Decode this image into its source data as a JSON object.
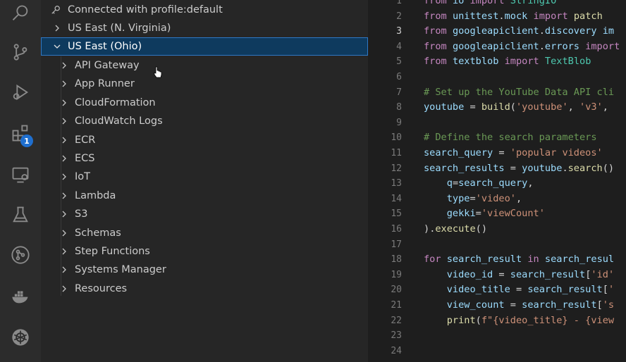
{
  "activity_bar": {
    "icons": [
      "search-icon",
      "source-control-icon",
      "run-debug-icon",
      "extensions-icon",
      "remote-explorer-icon",
      "testing-icon",
      "git-graph-icon",
      "docker-icon",
      "kubernetes-icon"
    ],
    "extensions_badge": "1"
  },
  "explorer": {
    "connection_label": "Connected with profile:default",
    "regions": [
      {
        "label": "US East (N. Virginia)",
        "expanded": false
      },
      {
        "label": "US East (Ohio)",
        "expanded": true
      }
    ],
    "services": [
      "API Gateway",
      "App Runner",
      "CloudFormation",
      "CloudWatch Logs",
      "ECR",
      "ECS",
      "IoT",
      "Lambda",
      "S3",
      "Schemas",
      "Step Functions",
      "Systems Manager",
      "Resources"
    ]
  },
  "editor": {
    "current_line": 3,
    "lines": [
      {
        "n": "1",
        "text": "from io import StringIO"
      },
      {
        "n": "2",
        "text": "from unittest.mock import patch"
      },
      {
        "n": "3",
        "text": "from googleapiclient.discovery im"
      },
      {
        "n": "4",
        "text": "from googleapiclient.errors import"
      },
      {
        "n": "5",
        "text": "from textblob import TextBlob"
      },
      {
        "n": "6",
        "text": ""
      },
      {
        "n": "7",
        "text": "# Set up the YouTube Data API cli"
      },
      {
        "n": "8",
        "text": "youtube = build('youtube', 'v3', "
      },
      {
        "n": "9",
        "text": ""
      },
      {
        "n": "10",
        "text": "# Define the search parameters"
      },
      {
        "n": "11",
        "text": "search_query = 'popular videos'"
      },
      {
        "n": "12",
        "text": "search_results = youtube.search()"
      },
      {
        "n": "13",
        "text": "    q=search_query,"
      },
      {
        "n": "14",
        "text": "    type='video',"
      },
      {
        "n": "15",
        "text": "    gekki='viewCount'"
      },
      {
        "n": "16",
        "text": ").execute()"
      },
      {
        "n": "17",
        "text": ""
      },
      {
        "n": "18",
        "text": "for search_result in search_resul"
      },
      {
        "n": "19",
        "text": "    video_id = search_result['id'"
      },
      {
        "n": "20",
        "text": "    video_title = search_result['"
      },
      {
        "n": "21",
        "text": "    view_count = search_result['s"
      },
      {
        "n": "22",
        "text": "    print(f\"{video_title} - {view"
      },
      {
        "n": "23",
        "text": ""
      },
      {
        "n": "24",
        "text": ""
      }
    ]
  }
}
